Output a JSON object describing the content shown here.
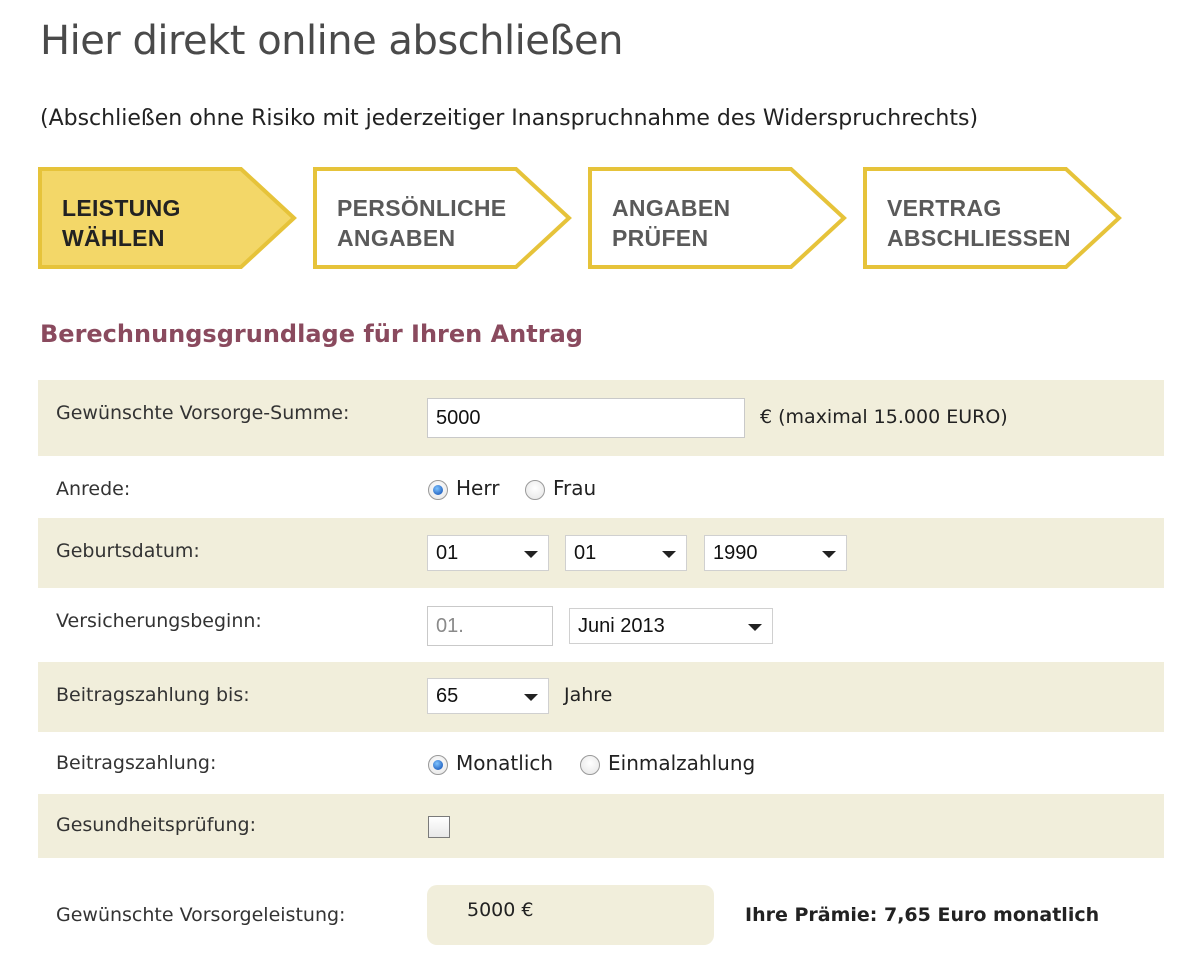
{
  "header": {
    "title": "Hier direkt online abschließen",
    "subtitle": "(Abschließen ohne Risiko mit jederzeitiger Inanspruchnahme des Widerspruchrechts)"
  },
  "steps": [
    {
      "line1": "LEISTUNG",
      "line2": "WÄHLEN",
      "active": true
    },
    {
      "line1": "PERSÖNLICHE",
      "line2": "ANGABEN",
      "active": false
    },
    {
      "line1": "ANGABEN",
      "line2": "PRÜFEN",
      "active": false
    },
    {
      "line1": "VERTRAG",
      "line2": "ABSCHLIESSEN",
      "active": false
    }
  ],
  "colors": {
    "step_active_fill": "#f3d768",
    "step_border": "#e6c33a",
    "row_shade": "#f1eedb",
    "section_title": "#8a4a5e"
  },
  "section_title": "Berechnungsgrundlage für Ihren Antrag",
  "form": {
    "sum": {
      "label": "Gewünschte Vorsorge-Summe:",
      "value": "5000",
      "hint": "€ (maximal 15.000 EURO)"
    },
    "salutation": {
      "label": "Anrede:",
      "options": [
        "Herr",
        "Frau"
      ],
      "selected": "Herr"
    },
    "birthdate": {
      "label": "Geburtsdatum:",
      "day": "01",
      "month": "01",
      "year": "1990"
    },
    "start": {
      "label": "Versicherungsbeginn:",
      "day_placeholder": "01.",
      "month_year": "Juni 2013"
    },
    "payment_until": {
      "label": "Beitragszahlung bis:",
      "value": "65",
      "unit": "Jahre"
    },
    "payment": {
      "label": "Beitragszahlung:",
      "options": [
        "Monatlich",
        "Einmalzahlung"
      ],
      "selected": "Monatlich"
    },
    "health_check": {
      "label": "Gesundheitsprüfung:",
      "checked": false
    },
    "result": {
      "label": "Gewünschte Vorsorgeleistung:",
      "value": "5000 €",
      "premium": "Ihre Prämie: 7,65 Euro monatlich"
    }
  }
}
